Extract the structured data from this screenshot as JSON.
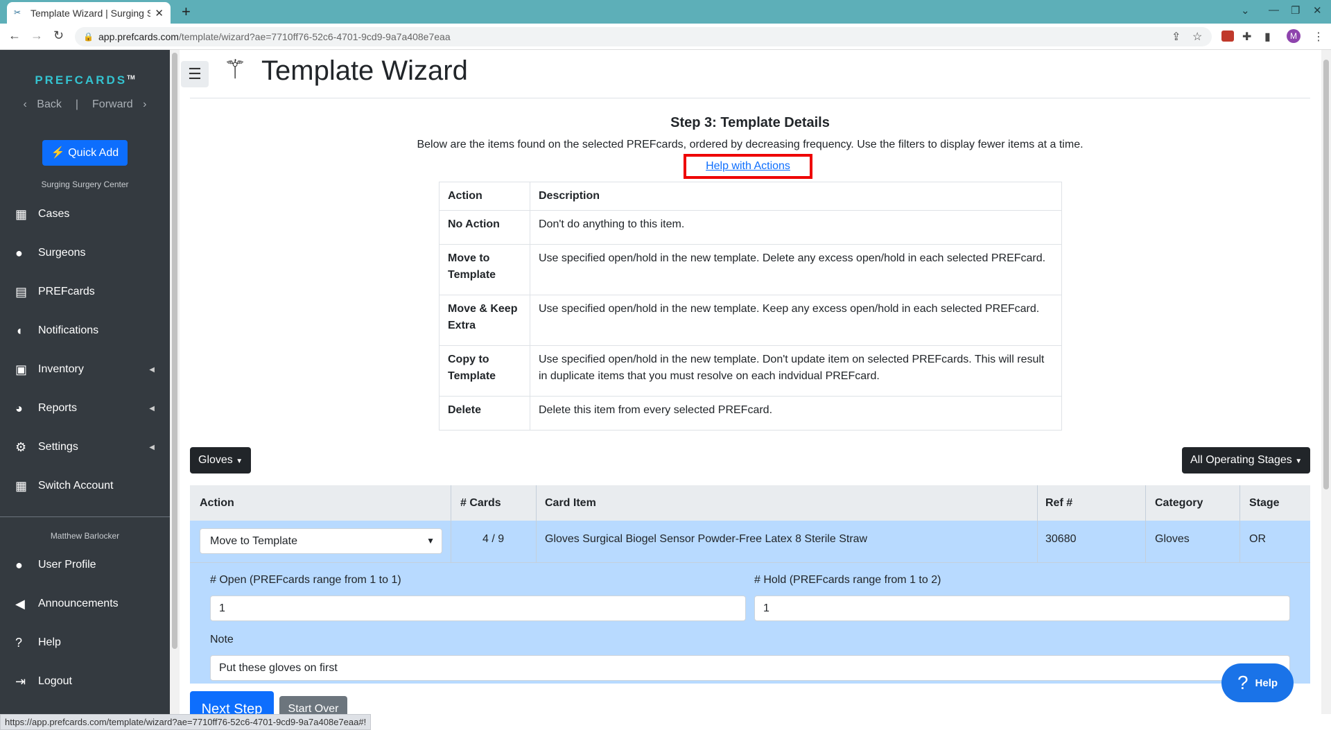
{
  "browser": {
    "tab_title": "Template Wizard | Surging Su",
    "url_host": "app.prefcards.com",
    "url_path": "/template/wizard?ae=7710ff76-52c6-4701-9cd9-9a7a408e7eaa",
    "profile_initial": "M",
    "status_url": "https://app.prefcards.com/template/wizard?ae=7710ff76-52c6-4701-9cd9-9a7a408e7eaa#!"
  },
  "sidebar": {
    "brand": "PREFCARDS",
    "brand_tm": "TM",
    "back": "Back",
    "forward": "Forward",
    "quick_add": "Quick Add",
    "facility": "Surging Surgery Center",
    "items": [
      {
        "label": "Cases"
      },
      {
        "label": "Surgeons"
      },
      {
        "label": "PREFcards"
      },
      {
        "label": "Notifications"
      },
      {
        "label": "Inventory"
      },
      {
        "label": "Reports"
      },
      {
        "label": "Settings"
      },
      {
        "label": "Switch Account"
      }
    ],
    "username": "Matthew Barlocker",
    "user_items": [
      {
        "label": "User Profile"
      },
      {
        "label": "Announcements"
      },
      {
        "label": "Help"
      },
      {
        "label": "Logout"
      }
    ]
  },
  "page": {
    "title": "Template Wizard",
    "step_title": "Step 3: Template Details",
    "step_desc": "Below are the items found on the selected PREFcards, ordered by decreasing frequency. Use the filters to display fewer items at a time.",
    "help_link": "Help with Actions"
  },
  "actions_table": {
    "headers": [
      "Action",
      "Description"
    ],
    "rows": [
      {
        "action": "No Action",
        "description": "Don't do anything to this item."
      },
      {
        "action": "Move to Template",
        "description": "Use specified open/hold in the new template. Delete any excess open/hold in each selected PREFcard."
      },
      {
        "action": "Move & Keep Extra",
        "description": "Use specified open/hold in the new template. Keep any excess open/hold in each selected PREFcard."
      },
      {
        "action": "Copy to Template",
        "description": "Use specified open/hold in the new template. Don't update item on selected PREFcards. This will result in duplicate items that you must resolve on each indvidual PREFcard."
      },
      {
        "action": "Delete",
        "description": "Delete this item from every selected PREFcard."
      }
    ]
  },
  "filters": {
    "category": "Gloves",
    "stage": "All Operating Stages"
  },
  "items_table": {
    "headers": {
      "action": "Action",
      "cards": "# Cards",
      "item": "Card Item",
      "ref": "Ref #",
      "category": "Category",
      "stage": "Stage"
    },
    "row": {
      "action": "Move to Template",
      "cards": "4 / 9",
      "item": "Gloves Surgical Biogel Sensor Powder-Free Latex 8 Sterile Straw",
      "ref": "30680",
      "category": "Gloves",
      "stage": "OR",
      "open_label": "# Open (PREFcards range from 1 to 1)",
      "open_value": "1",
      "hold_label": "# Hold (PREFcards range from 1 to 2)",
      "hold_value": "1",
      "note_label": "Note",
      "note_value": "Put these gloves on first"
    }
  },
  "buttons": {
    "next": "Next Step",
    "start_over": "Start Over",
    "help_fab": "Help"
  }
}
